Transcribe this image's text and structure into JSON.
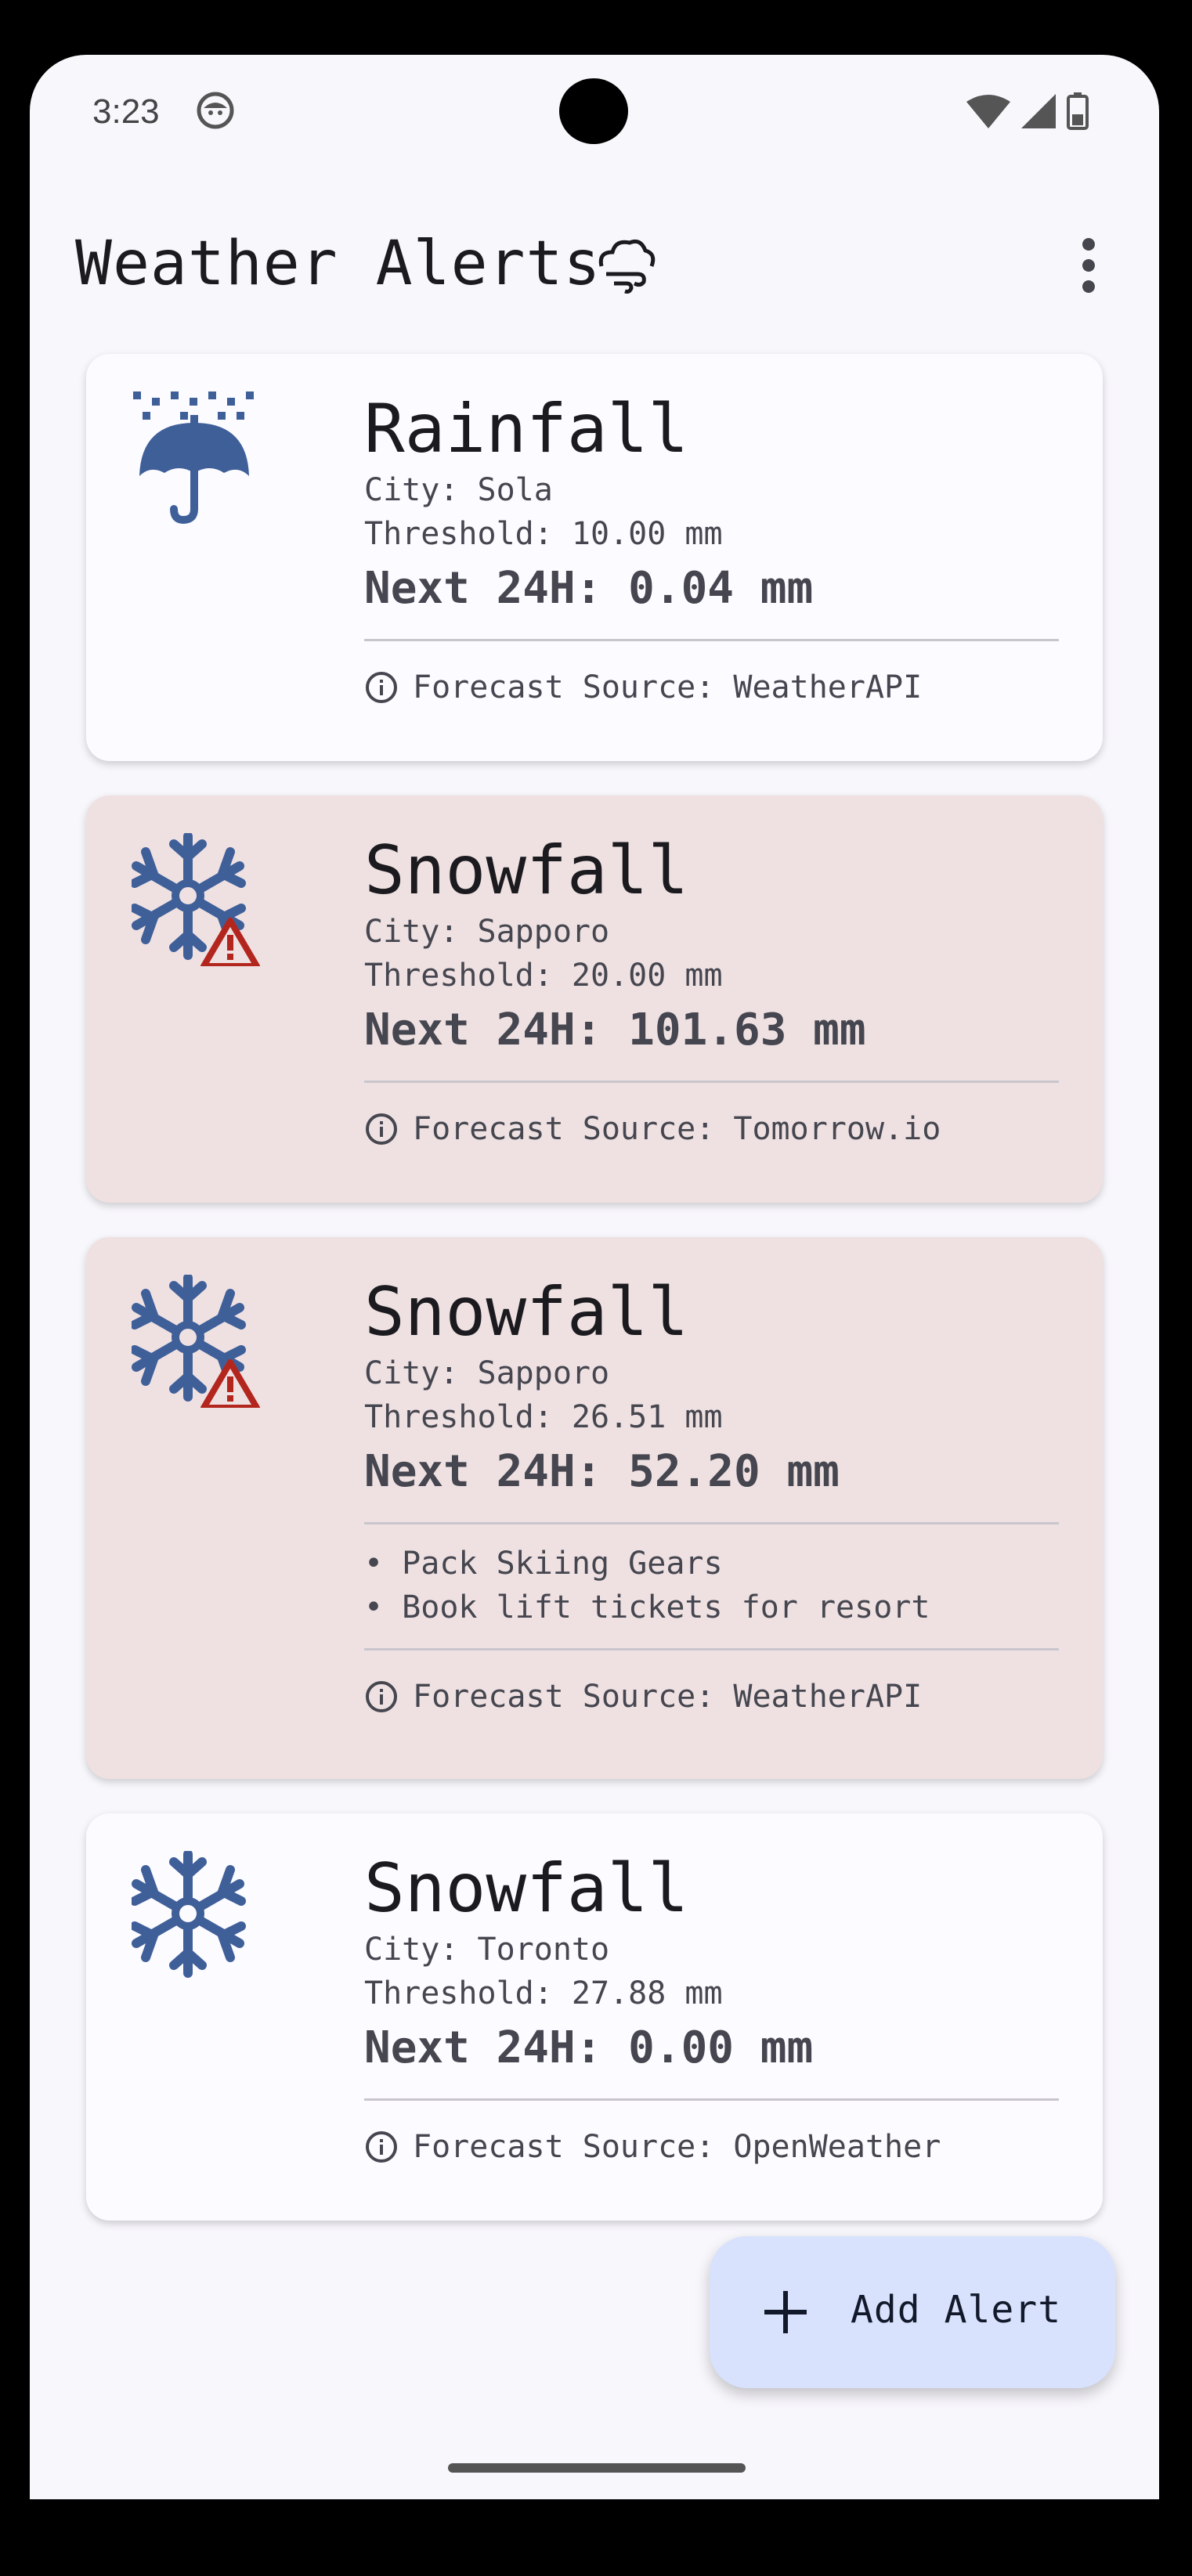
{
  "status_bar": {
    "time": "3:23"
  },
  "app_bar": {
    "title": "Weather Alerts"
  },
  "alerts": [
    {
      "title": "Rainfall",
      "city": "City: Sola",
      "threshold": "Threshold: 10.00 mm",
      "next24": "Next 24H: 0.04 mm",
      "source": "Forecast Source: WeatherAPI",
      "icon": "umbrella-rain-icon",
      "exceeded": false
    },
    {
      "title": "Snowfall",
      "city": "City: Sapporo",
      "threshold": "Threshold: 20.00 mm",
      "next24": "Next 24H: 101.63 mm",
      "source": "Forecast Source: Tomorrow.io",
      "icon": "snowflake-icon",
      "exceeded": true
    },
    {
      "title": "Snowfall",
      "city": "City: Sapporo",
      "threshold": "Threshold: 26.51 mm",
      "next24": "Next 24H: 52.20 mm",
      "tasks": [
        "• Pack Skiing Gears",
        "• Book lift tickets for resort"
      ],
      "source": "Forecast Source: WeatherAPI",
      "icon": "snowflake-icon",
      "exceeded": true
    },
    {
      "title": "Snowfall",
      "city": "City: Toronto",
      "threshold": "Threshold: 27.88 mm",
      "next24": "Next 24H: 0.00 mm",
      "source": "Forecast Source: OpenWeather",
      "icon": "snowflake-icon",
      "exceeded": false
    }
  ],
  "fab": {
    "label": "Add Alert"
  },
  "colors": {
    "icon_blue": "#3f5f99",
    "warning_red": "#b3261e",
    "alert_card_bg": "#efe1e2",
    "fab_bg": "#d8e2fd"
  }
}
